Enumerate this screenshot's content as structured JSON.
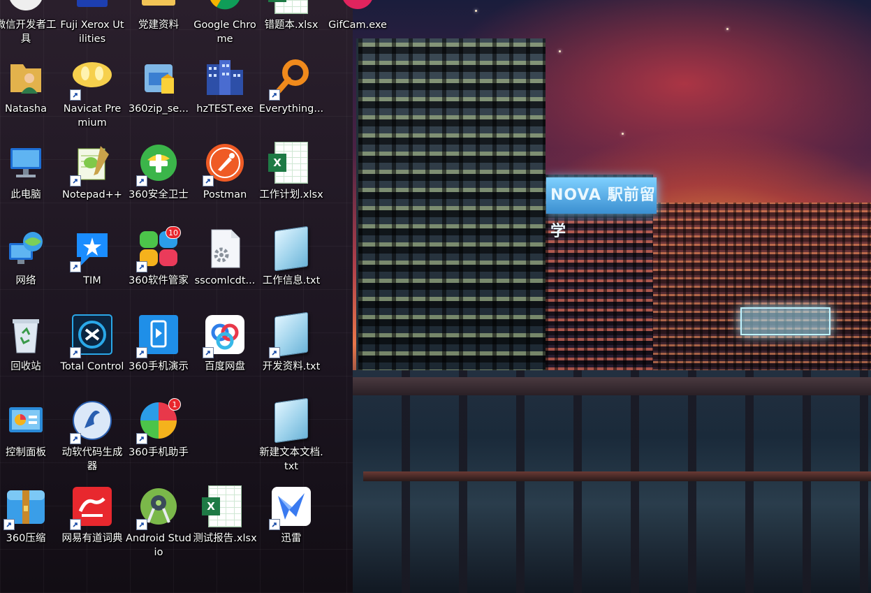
{
  "desktop": {
    "row0": [
      {
        "label": "微信开发者工具",
        "icon": "wechat-devtools-icon"
      },
      {
        "label": "Fuji Xerox Utilities",
        "icon": "fuji-xerox-icon"
      },
      {
        "label": "党建资料",
        "icon": "folder-icon"
      },
      {
        "label": "Google Chrome",
        "icon": "chrome-icon"
      },
      {
        "label": "错题本.xlsx",
        "icon": "excel-file-icon"
      },
      {
        "label": "GifCam.exe",
        "icon": "gifcam-icon"
      }
    ],
    "row1": [
      {
        "label": "Natasha",
        "icon": "user-folder-icon"
      },
      {
        "label": "Navicat Premium",
        "icon": "navicat-icon"
      },
      {
        "label": "360zip_se...",
        "icon": "installer-icon"
      },
      {
        "label": "hzTEST.exe",
        "icon": "building-exe-icon"
      },
      {
        "label": "Everything...",
        "icon": "everything-search-icon"
      }
    ],
    "row2": [
      {
        "label": "此电脑",
        "icon": "this-pc-icon"
      },
      {
        "label": "Notepad++",
        "icon": "notepadpp-icon"
      },
      {
        "label": "360安全卫士",
        "icon": "360-safe-icon"
      },
      {
        "label": "Postman",
        "icon": "postman-icon"
      },
      {
        "label": "工作计划.xlsx",
        "icon": "excel-file-icon"
      }
    ],
    "row3": [
      {
        "label": "网络",
        "icon": "network-icon"
      },
      {
        "label": "TIM",
        "icon": "tim-icon"
      },
      {
        "label": "360软件管家",
        "icon": "360-software-icon",
        "badge": "10"
      },
      {
        "label": "sscomlcdt...",
        "icon": "settings-file-icon"
      },
      {
        "label": "工作信息.txt",
        "icon": "text-file-icon"
      }
    ],
    "row4": [
      {
        "label": "回收站",
        "icon": "recycle-bin-icon"
      },
      {
        "label": "Total Control",
        "icon": "total-control-icon"
      },
      {
        "label": "360手机演示",
        "icon": "360-phone-demo-icon"
      },
      {
        "label": "百度网盘",
        "icon": "baidu-netdisk-icon"
      },
      {
        "label": "开发资料.txt",
        "icon": "text-file-icon"
      }
    ],
    "row5": [
      {
        "label": "控制面板",
        "icon": "control-panel-icon"
      },
      {
        "label": "动软代码生成器",
        "icon": "code-generator-icon"
      },
      {
        "label": "360手机助手",
        "icon": "360-phone-assistant-icon",
        "badge": "1"
      },
      {
        "label": "新建文本文档.txt",
        "icon": "text-file-icon"
      }
    ],
    "row6": [
      {
        "label": "360压缩",
        "icon": "360-zip-icon"
      },
      {
        "label": "网易有道词典",
        "icon": "youdao-icon"
      },
      {
        "label": "Android Studio",
        "icon": "android-studio-icon"
      },
      {
        "label": "测试报告.xlsx",
        "icon": "excel-file-icon"
      },
      {
        "label": "迅雷",
        "icon": "xunlei-icon"
      }
    ]
  },
  "wallpaper": {
    "sign_text": "NOVA 駅前留学"
  },
  "colors": {
    "label_text": "#ffffff",
    "excel_green": "#1e7a45",
    "badge_red": "#e8262c"
  }
}
